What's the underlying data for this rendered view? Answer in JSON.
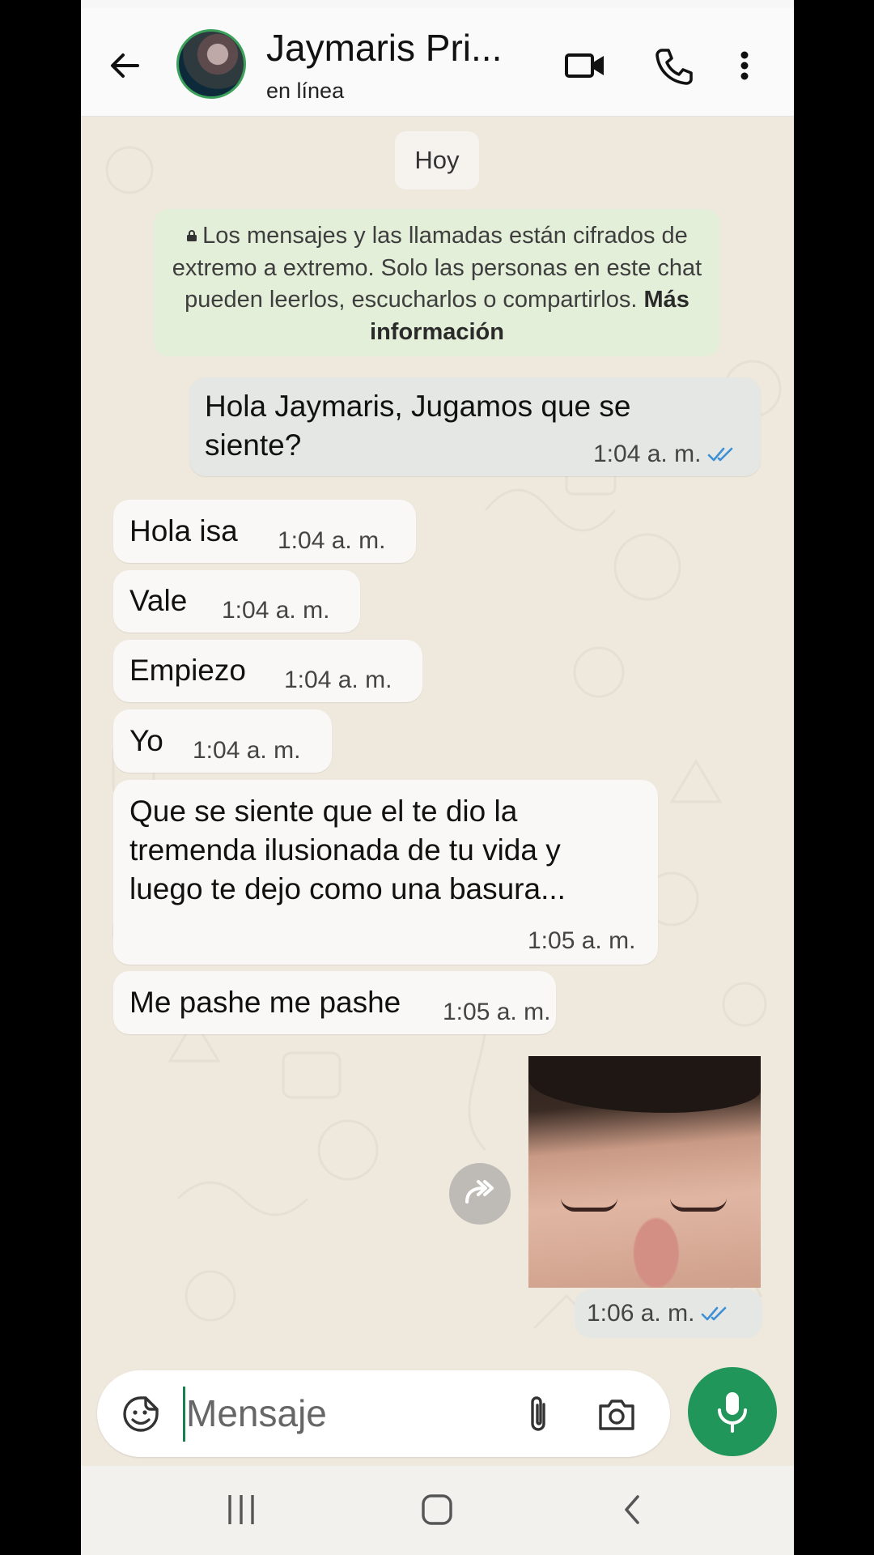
{
  "header": {
    "contact_name": "Jaymaris Pri...",
    "status": "en línea",
    "icons": [
      "back-arrow-icon",
      "avatar",
      "video-call-icon",
      "phone-call-icon",
      "more-options-icon"
    ]
  },
  "chat": {
    "date_chip": "Hoy",
    "encryption_notice": {
      "text": "Los mensajes y las llamadas están cifrados de extremo a extremo. Solo las personas en este chat pueden leerlos, escucharlos o compartirlos.",
      "link": "Más información"
    },
    "messages": [
      {
        "direction": "out",
        "text": "Hola Jaymaris, Jugamos que se siente?",
        "time": "1:04 a. m.",
        "read": true
      },
      {
        "direction": "in",
        "text": "Hola isa",
        "time": "1:04 a. m."
      },
      {
        "direction": "in",
        "text": "Vale",
        "time": "1:04 a. m."
      },
      {
        "direction": "in",
        "text": "Empiezo",
        "time": "1:04 a. m."
      },
      {
        "direction": "in",
        "text": "Yo",
        "time": "1:04 a. m."
      },
      {
        "direction": "in",
        "text": "Que se siente que el te dio la tremenda ilusionada de tu vida y luego te dejo como una basura...",
        "time": "1:05 a. m."
      },
      {
        "direction": "in",
        "text": "Me pashe me pashe",
        "time": "1:05 a. m."
      },
      {
        "direction": "out",
        "type": "image",
        "time": "1:06 a. m.",
        "read": true
      }
    ]
  },
  "composer": {
    "placeholder": "Mensaje"
  },
  "colors": {
    "accent_green": "#21965b",
    "read_ticks": "#3d8fd6",
    "chat_background": "#efe8dd"
  }
}
